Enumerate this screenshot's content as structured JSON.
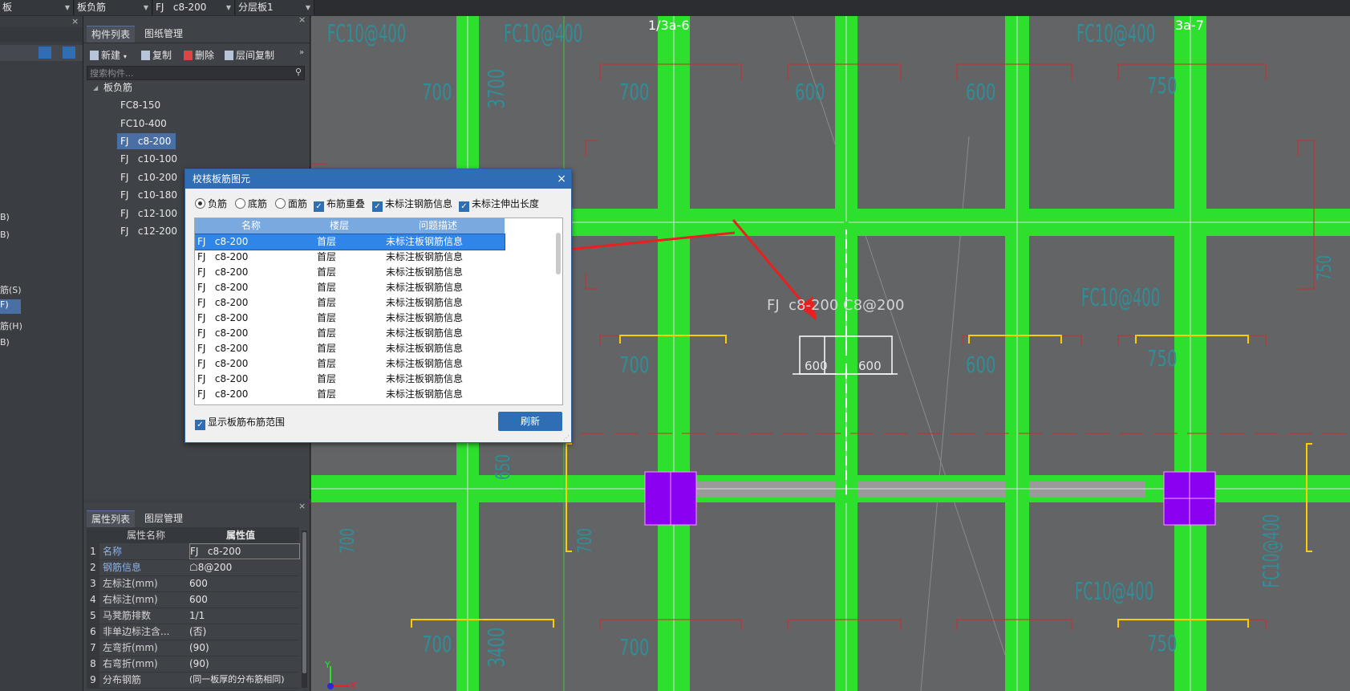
{
  "toolbar": {
    "combo1": "板",
    "combo2": "板负筋",
    "combo3": "FJ   c8-200",
    "combo4": "分层板1"
  },
  "left_panel": {
    "items": [
      "B)",
      "B)",
      "筋(S)",
      "F)",
      "筋(H)",
      "B)"
    ]
  },
  "component_panel": {
    "tabs": [
      "构件列表",
      "图纸管理"
    ],
    "tools": {
      "new": "新建",
      "copy": "复制",
      "delete": "删除",
      "floor_copy": "层间复制"
    },
    "search_placeholder": "搜索构件...",
    "tree_root": "板负筋",
    "items": [
      "FC8-150",
      "FC10-400",
      "FJ   c8-200",
      "FJ   c10-100",
      "FJ   c10-200",
      "FJ   c10-180",
      "FJ   c12-100",
      "FJ   c12-200"
    ]
  },
  "property_panel": {
    "tabs": [
      "属性列表",
      "图层管理"
    ],
    "headers": {
      "name": "属性名称",
      "value": "属性值"
    },
    "rows": [
      {
        "num": "1",
        "name": "名称",
        "value": "FJ   c8-200"
      },
      {
        "num": "2",
        "name": "钢筋信息",
        "value": "☖8@200"
      },
      {
        "num": "3",
        "name": "左标注(mm)",
        "value": "600"
      },
      {
        "num": "4",
        "name": "右标注(mm)",
        "value": "600"
      },
      {
        "num": "5",
        "name": "马凳筋排数",
        "value": "1/1"
      },
      {
        "num": "6",
        "name": "非单边标注含...",
        "value": "(否)"
      },
      {
        "num": "7",
        "name": "左弯折(mm)",
        "value": "(90)"
      },
      {
        "num": "8",
        "name": "右弯折(mm)",
        "value": "(90)"
      },
      {
        "num": "9",
        "name": "分布钢筋",
        "value": "(同一板厚的分布筋相同)"
      }
    ]
  },
  "dialog": {
    "title": "校核板筋图元",
    "close": "×",
    "options": {
      "neg": "负筋",
      "bottom": "底筋",
      "top": "面筋",
      "overlap": "布筋重叠",
      "unlabeled_info": "未标注钢筋信息",
      "unlabeled_len": "未标注伸出长度"
    },
    "columns": [
      "名称",
      "楼层",
      "问题描述"
    ],
    "rows": [
      [
        "FJ   c8-200",
        "首层",
        "未标注板钢筋信息"
      ],
      [
        "FJ   c8-200",
        "首层",
        "未标注板钢筋信息"
      ],
      [
        "FJ   c8-200",
        "首层",
        "未标注板钢筋信息"
      ],
      [
        "FJ   c8-200",
        "首层",
        "未标注板钢筋信息"
      ],
      [
        "FJ   c8-200",
        "首层",
        "未标注板钢筋信息"
      ],
      [
        "FJ   c8-200",
        "首层",
        "未标注板钢筋信息"
      ],
      [
        "FJ   c8-200",
        "首层",
        "未标注板钢筋信息"
      ],
      [
        "FJ   c8-200",
        "首层",
        "未标注板钢筋信息"
      ],
      [
        "FJ   c8-200",
        "首层",
        "未标注板钢筋信息"
      ],
      [
        "FJ   c8-200",
        "首层",
        "未标注板钢筋信息"
      ],
      [
        "FJ   c8-200",
        "首层",
        "未标注板钢筋信息"
      ]
    ],
    "show_range": "显示板筋布筋范围",
    "refresh": "刷新"
  },
  "canvas": {
    "axis_labels": [
      "1/3a-6",
      "3a-7"
    ],
    "annotation": "FJ  c8-200 C8@200",
    "dim_left": "600",
    "dim_right": "600",
    "dims": [
      "700",
      "700",
      "600",
      "600",
      "750",
      "700",
      "600",
      "750",
      "700",
      "700",
      "750",
      "700",
      "700",
      "750"
    ],
    "vertical_dims": [
      "3700",
      "3400",
      "650"
    ],
    "rebar_labels": [
      "FC10@400",
      "FC10@400",
      "FC10@400",
      "FC10@400",
      "FC10@400",
      "FC10@400"
    ],
    "ucs_x": "X",
    "ucs_y": "Y"
  }
}
